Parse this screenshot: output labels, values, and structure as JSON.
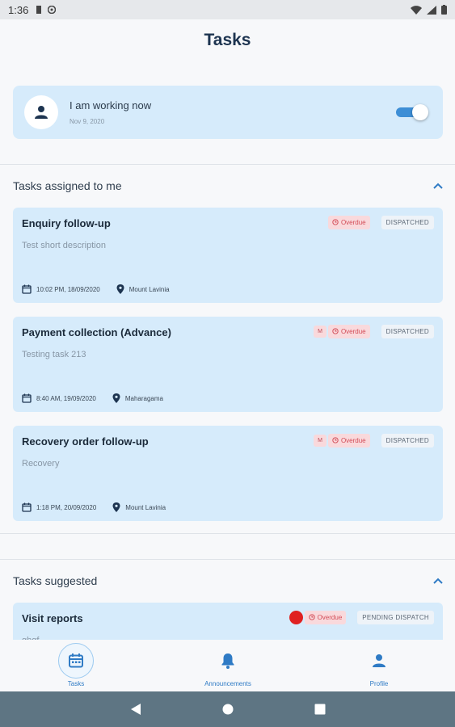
{
  "status_bar": {
    "time": "1:36"
  },
  "header": {
    "title": "Tasks"
  },
  "work_status": {
    "title": "I am working now",
    "date": "Nov 9, 2020",
    "toggle_on": true
  },
  "sections": {
    "assigned": {
      "label": "Tasks assigned to me"
    },
    "suggested": {
      "label": "Tasks suggested"
    }
  },
  "tasks": [
    {
      "title": "Enquiry follow-up",
      "description": "Test short description",
      "priority": "",
      "overdue": "Overdue",
      "status": "DISPATCHED",
      "datetime": "10:02 PM, 18/09/2020",
      "location": "Mount Lavinia"
    },
    {
      "title": "Payment collection (Advance)",
      "description": "Testing task 213",
      "priority": "M",
      "overdue": "Overdue",
      "status": "DISPATCHED",
      "datetime": "8:40 AM, 19/09/2020",
      "location": "Maharagama"
    },
    {
      "title": "Recovery order follow-up",
      "description": "Recovery",
      "priority": "M",
      "overdue": "Overdue",
      "status": "DISPATCHED",
      "datetime": "1:18 PM, 20/09/2020",
      "location": "Mount Lavinia"
    }
  ],
  "suggested_tasks": [
    {
      "title": "Visit reports",
      "description": "ghgf",
      "overdue": "Overdue",
      "status": "PENDING DISPATCH"
    }
  ],
  "bottom_nav": {
    "items": [
      {
        "label": "Tasks",
        "icon": "calendar-icon",
        "active": true
      },
      {
        "label": "Announcements",
        "icon": "bell-icon",
        "active": false
      },
      {
        "label": "Profile",
        "icon": "person-icon",
        "active": false
      }
    ]
  },
  "colors": {
    "accent": "#2f7bc5",
    "card_bg": "#d6ebfb",
    "overdue_bg": "#f9d9dc",
    "overdue_text": "#d24b56",
    "title": "#1d3450"
  }
}
